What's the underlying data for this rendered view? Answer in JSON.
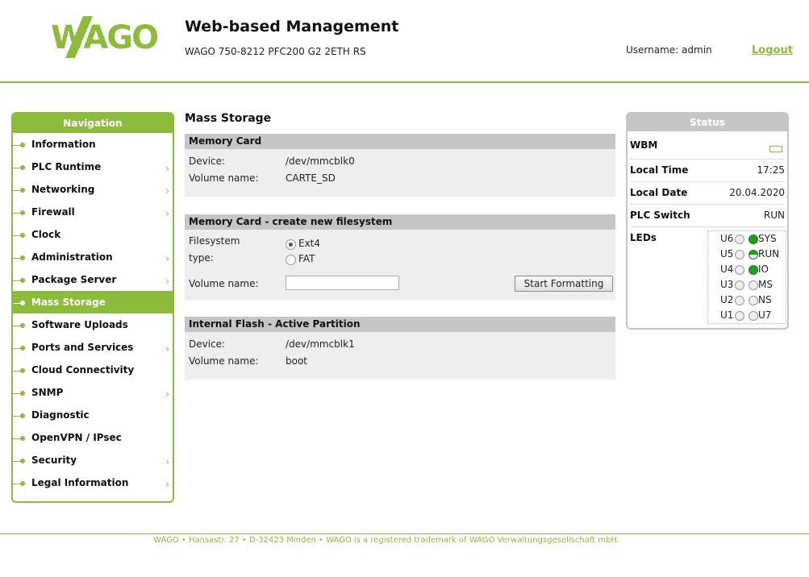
{
  "header": {
    "logo_text": "WAGO",
    "title": "Web-based Management",
    "subtitle": "WAGO 750-8212 PFC200 G2 2ETH RS",
    "username": "Username: admin",
    "logout": "Logout",
    "accent_color": "#8dbb3c"
  },
  "nav": {
    "title": "Navigation",
    "items": [
      {
        "label": "Information",
        "has_sub": false
      },
      {
        "label": "PLC Runtime",
        "has_sub": true
      },
      {
        "label": "Networking",
        "has_sub": true
      },
      {
        "label": "Firewall",
        "has_sub": true
      },
      {
        "label": "Clock",
        "has_sub": false
      },
      {
        "label": "Administration",
        "has_sub": true
      },
      {
        "label": "Package Server",
        "has_sub": true
      },
      {
        "label": "Mass Storage",
        "has_sub": false,
        "active": true
      },
      {
        "label": "Software Uploads",
        "has_sub": false
      },
      {
        "label": "Ports and Services",
        "has_sub": true
      },
      {
        "label": "Cloud Connectivity",
        "has_sub": false
      },
      {
        "label": "SNMP",
        "has_sub": true
      },
      {
        "label": "Diagnostic",
        "has_sub": false
      },
      {
        "label": "OpenVPN / IPsec",
        "has_sub": false
      },
      {
        "label": "Security",
        "has_sub": true
      },
      {
        "label": "Legal Information",
        "has_sub": true
      }
    ]
  },
  "main": {
    "page_title": "Mass Storage",
    "memory_card": {
      "title": "Memory Card",
      "device_label": "Device:",
      "device_value": "/dev/mmcblk0",
      "volume_label": "Volume name:",
      "volume_value": "CARTE_SD"
    },
    "create_fs": {
      "title": "Memory Card - create new filesystem",
      "fs_type_label": "Filesystem type:",
      "options": [
        "Ext4",
        "FAT"
      ],
      "selected": "Ext4",
      "volume_label": "Volume name:",
      "volume_value": "",
      "button": "Start Formatting"
    },
    "internal_flash": {
      "title": "Internal Flash - Active Partition",
      "device_label": "Device:",
      "device_value": "/dev/mmcblk1",
      "volume_label": "Volume name:",
      "volume_value": "boot"
    }
  },
  "status": {
    "title": "Status",
    "wbm_label": "WBM",
    "local_time_label": "Local Time",
    "local_time": "17:25",
    "local_date_label": "Local Date",
    "local_date": "20.04.2020",
    "plc_switch_label": "PLC Switch",
    "plc_switch": "RUN",
    "leds_label": "LEDs",
    "leds": [
      {
        "left": "U6",
        "right": "SYS",
        "state": "green"
      },
      {
        "left": "U5",
        "right": "RUN",
        "state": "half"
      },
      {
        "left": "U4",
        "right": "IO",
        "state": "green"
      },
      {
        "left": "U3",
        "right": "MS",
        "state": "off"
      },
      {
        "left": "U2",
        "right": "NS",
        "state": "off"
      },
      {
        "left": "U1",
        "right": "U7",
        "state": "off"
      }
    ]
  },
  "footer": {
    "text": "WAGO • Hansastr. 27 • D-32423 Minden • WAGO is a registered trademark of WAGO Verwaltungsgesellschaft mbH."
  }
}
